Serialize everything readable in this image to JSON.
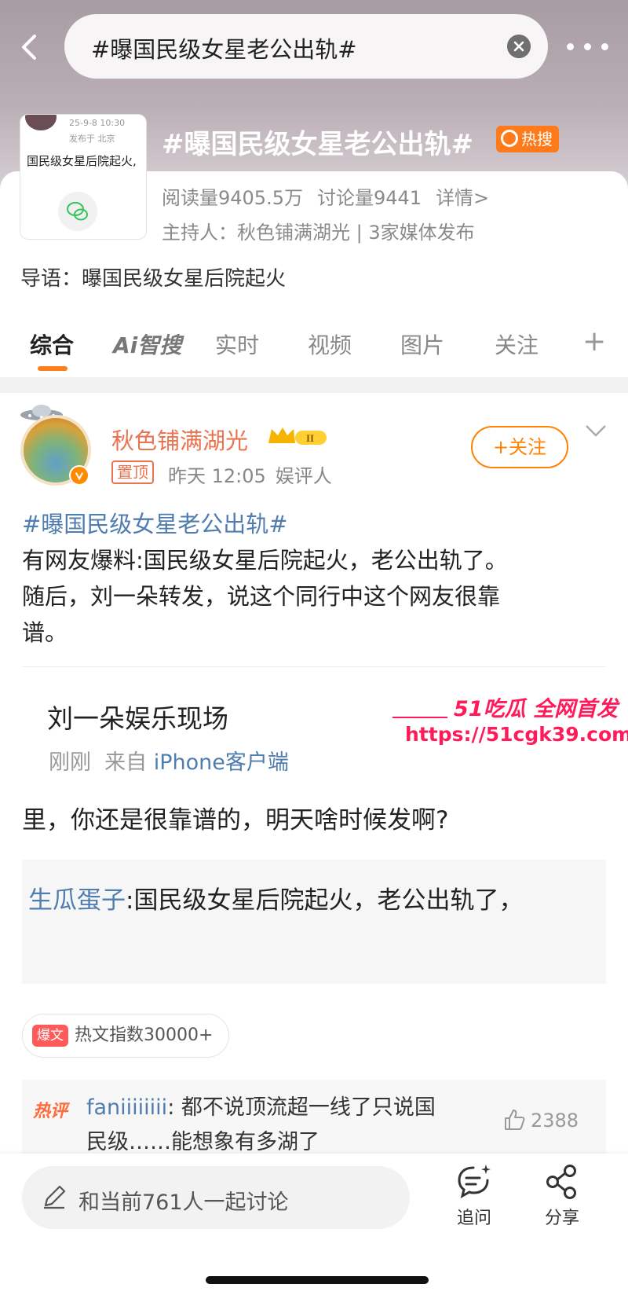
{
  "search": {
    "query": "#曝国民级女星老公出轨#"
  },
  "topic": {
    "title": "#曝国民级女星老公出轨#",
    "hot_badge": "热搜",
    "thumb_date": "25-9-8 10:30",
    "thumb_location": "发布于 北京",
    "thumb_text": "国民级女星后院起火,",
    "reads": "阅读量9405.5万",
    "discussions": "讨论量9441",
    "details": "详情>",
    "host": "主持人：秋色铺满湖光 | 3家媒体发布",
    "lead": "导语：曝国民级女星后院起火"
  },
  "tabs": {
    "comprehensive": "综合",
    "ai_search": "Ai智搜",
    "realtime": "实时",
    "video": "视频",
    "images": "图片",
    "follow": "关注",
    "add": "+"
  },
  "post": {
    "author": "秋色铺满湖光",
    "level": "II",
    "pinned": "置顶",
    "time": "昨天 12:05",
    "category": "娱评人",
    "follow_label": "+关注",
    "hashtag": "#曝国民级女星老公出轨#",
    "line1": "有网友爆料:国民级女星后院起火，老公出轨了。",
    "line2": "随后，刘一朵转发，说这个同行中这个网友很靠",
    "line3": "谱。",
    "embed": {
      "name": "刘一朵娱乐现场",
      "time": "刚刚",
      "from_label": "来自",
      "source": "iPhone客户端",
      "reply": "里，你还是很靠谱的，明天啥时候发啊?",
      "quote_nick": "生瓜蛋子",
      "quote_text": ":国民级女星后院起火，老公出轨了，"
    }
  },
  "watermark": {
    "brand": "51吃瓜 全网首发",
    "url": "https://51cgk39.com"
  },
  "hot_article": {
    "badge": "爆文",
    "text": "热文指数30000+"
  },
  "hot_comment": {
    "label": "热评",
    "user": "faniiiiiiii",
    "line1": ": 都不说顶流超一线了只说国",
    "line2": "民级……能想象有多湖了",
    "likes": "2388"
  },
  "bottom": {
    "discuss_placeholder": "和当前761人一起讨论",
    "ask_label": "追问",
    "share_label": "分享"
  },
  "colors": {
    "accent_orange": "#ff8200",
    "link_blue": "#507daf",
    "author_orange": "#eb7350",
    "watermark_pink": "#ff1b5a"
  }
}
